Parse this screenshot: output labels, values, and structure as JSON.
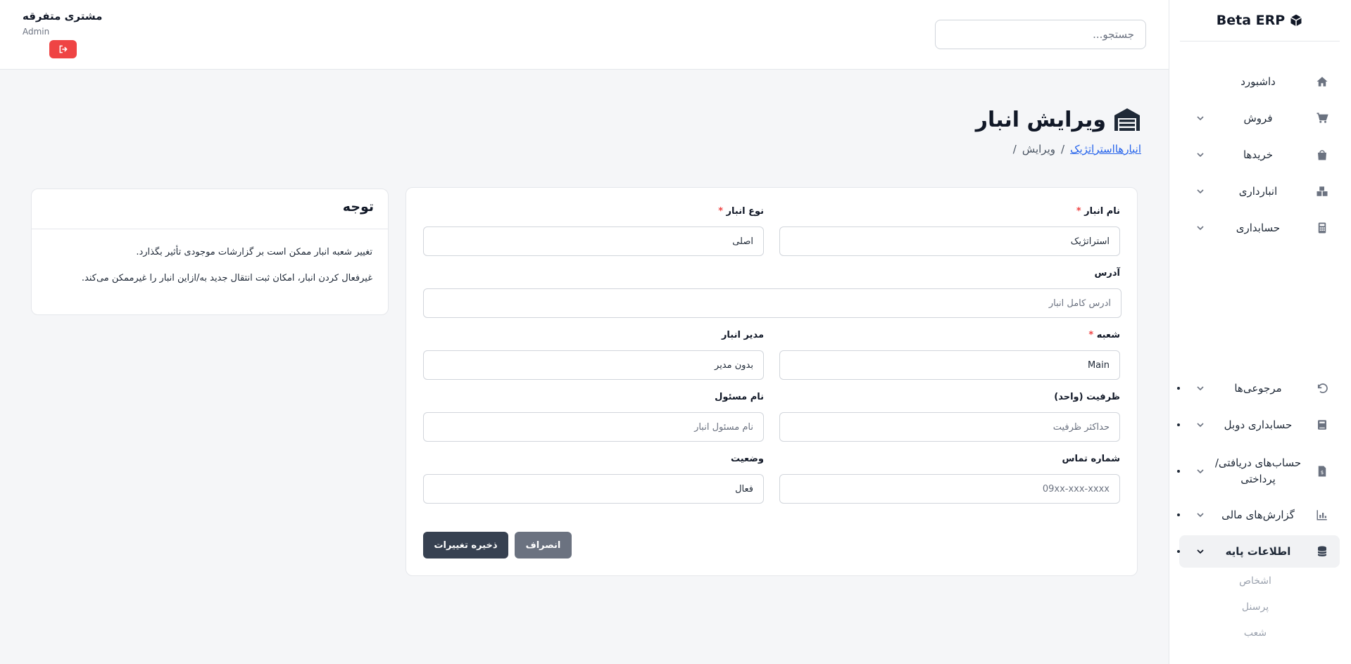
{
  "app": {
    "brand": "Beta ERP"
  },
  "sidebar": {
    "items": [
      {
        "label": "داشبورد",
        "icon": "home-icon"
      },
      {
        "label": "فروش",
        "icon": "cart-icon"
      },
      {
        "label": "خریدها",
        "icon": "shopping-bag-icon"
      },
      {
        "label": "انبارداری",
        "icon": "boxes-icon"
      },
      {
        "label": "حسابداری",
        "icon": "calculator-icon"
      },
      {
        "label": "مرجوعی‌ها",
        "icon": "undo-icon"
      },
      {
        "label": "حسابداری دوبل",
        "icon": "book-icon"
      },
      {
        "label": "حساب‌های دریافتی/پرداختی",
        "icon": "invoice-icon"
      },
      {
        "label": "گزارش‌های مالی",
        "icon": "chart-icon"
      },
      {
        "label": "اطلاعات پایه",
        "icon": "database-icon"
      }
    ],
    "subitems": [
      {
        "label": "اشخاص"
      },
      {
        "label": "پرسنل"
      },
      {
        "label": "شعب"
      }
    ]
  },
  "topbar": {
    "search_placeholder": "جستجو...",
    "user_name": "مشتری متفرقه",
    "user_role": "Admin"
  },
  "page": {
    "title": "ویرایش انبار",
    "breadcrumb": {
      "link": "انبارهااستراتژیک",
      "separator": "/",
      "current": "ویرایش",
      "trailing": "/"
    }
  },
  "form": {
    "warehouse_name": {
      "label": "نام انبار",
      "required": "*",
      "value": "استراتژیک"
    },
    "warehouse_type": {
      "label": "نوع انبار",
      "required": "*",
      "value": "اصلی"
    },
    "address": {
      "label": "آدرس",
      "placeholder": "آدرس کامل انبار"
    },
    "branch": {
      "label": "شعبه",
      "required": "*",
      "value": "Main"
    },
    "manager": {
      "label": "مدیر انبار",
      "value": "بدون مدیر"
    },
    "capacity": {
      "label": "ظرفیت (واحد)",
      "placeholder": "حداکثر ظرفیت"
    },
    "responsible": {
      "label": "نام مسئول",
      "placeholder": "نام مسئول انبار"
    },
    "phone": {
      "label": "شماره تماس",
      "placeholder": "09xx-xxx-xxxx"
    },
    "status": {
      "label": "وضعیت",
      "value": "فعال"
    },
    "save_label": "ذخیره تغییرات",
    "cancel_label": "انصراف"
  },
  "note": {
    "title": "توجه",
    "line1": "تغییر شعبه انبار ممکن است بر گزارشات موجودی تأثیر بگذارد.",
    "line2": "غیرفعال کردن انبار، امکان ثبت انتقال جدید به/ازاین انبار را غیرممکن می‌کند."
  },
  "colors": {
    "accent": "#374151",
    "danger": "#ef4444",
    "link": "#2563eb"
  }
}
